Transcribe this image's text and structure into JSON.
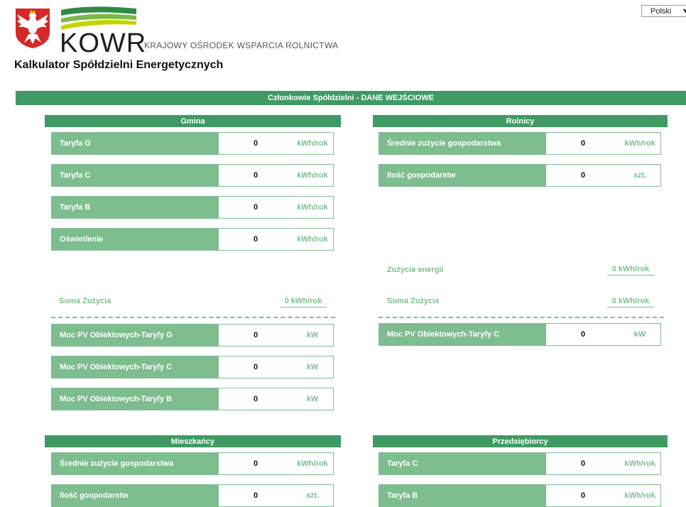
{
  "header": {
    "logo_text": "KOWR",
    "logo_subtitle": "KRAJOWY OŚRODEK WSPARCIA ROLNICTWA",
    "app_title": "Kalkulator Spółdzielni Energetycznych",
    "language": "Polski"
  },
  "main_section": {
    "title": "Członkowie Spółdzielni - DANE WEJŚCIOWE"
  },
  "gmina": {
    "title": "Gmina",
    "rows": [
      {
        "label": "Taryfa G",
        "value": "0",
        "unit": "kWh/rok"
      },
      {
        "label": "Taryfa C",
        "value": "0",
        "unit": "kWh/rok"
      },
      {
        "label": "Taryfa B",
        "value": "0",
        "unit": "kWh/rok"
      },
      {
        "label": "Oświetlenie",
        "value": "0",
        "unit": "kWh/rok"
      }
    ],
    "sum_label": "Suma Zużycia",
    "sum_value": "0 kWh/rok",
    "pv_rows": [
      {
        "label": "Moc PV Obiektowych-Taryfy G",
        "value": "0",
        "unit": "kW"
      },
      {
        "label": "Moc PV Obiektowych-Taryfy C",
        "value": "0",
        "unit": "kW"
      },
      {
        "label": "Moc PV Obiektowych-Taryfy B",
        "value": "0",
        "unit": "kW"
      }
    ]
  },
  "rolnicy": {
    "title": "Rolnicy",
    "rows": [
      {
        "label": "Średnie zużycie gospodarstwa",
        "value": "0",
        "unit": "kWh/rok"
      },
      {
        "label": "Ilość gospodarstw",
        "value": "0",
        "unit": "szt."
      }
    ],
    "energy_label": "Zużycie energii",
    "energy_value": "0 kWh/rok",
    "sum_label": "Suma Zużycia",
    "sum_value": "0 kWh/rok",
    "pv_rows": [
      {
        "label": "Moc PV Obiektowych-Taryfy C",
        "value": "0",
        "unit": "kW"
      }
    ]
  },
  "mieszkancy": {
    "title": "Mieszkańcy",
    "rows": [
      {
        "label": "Średnie zużycie gospodarstwa",
        "value": "0",
        "unit": "kWh/rok"
      },
      {
        "label": "Ilość gospodarstw",
        "value": "0",
        "unit": "szt."
      }
    ]
  },
  "przedsiebiorcy": {
    "title": "Przedsiębiorcy",
    "rows": [
      {
        "label": "Taryfa C",
        "value": "0",
        "unit": "kWh/rok"
      },
      {
        "label": "Taryfa B",
        "value": "0",
        "unit": "kWh/rok"
      }
    ]
  },
  "colors": {
    "dark_green": "#3f9a63",
    "light_green": "#7ebd8f",
    "eagle_red": "#d62828"
  }
}
